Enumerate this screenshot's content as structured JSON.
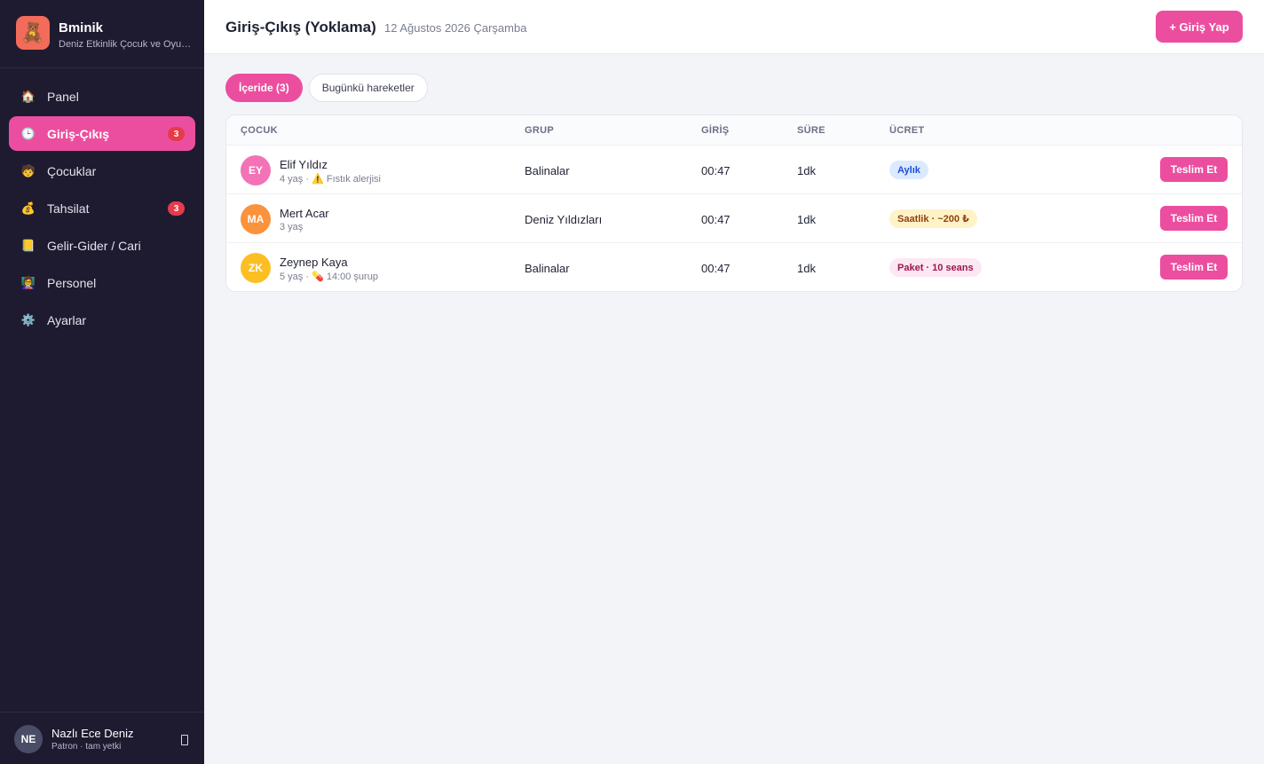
{
  "brand": {
    "logo_emoji": "🧸",
    "name": "Bminik",
    "subtitle": "Deniz Etkinlik Çocuk ve Oyun Merkezi"
  },
  "sidebar": {
    "items": [
      {
        "label": "Panel",
        "icon": "home-icon",
        "glyph": "🏠",
        "badge": ""
      },
      {
        "label": "Giriş-Çıkış",
        "icon": "clock-icon",
        "glyph": "🕒",
        "badge": "3",
        "active": true
      },
      {
        "label": "Çocuklar",
        "icon": "child-icon",
        "glyph": "🧒",
        "badge": ""
      },
      {
        "label": "Tahsilat",
        "icon": "money-bag-icon",
        "glyph": "💰",
        "badge": "3"
      },
      {
        "label": "Gelir-Gider / Cari",
        "icon": "ledger-icon",
        "glyph": "📒",
        "badge": ""
      },
      {
        "label": "Personel",
        "icon": "staff-icon",
        "glyph": "👩‍🏫",
        "badge": ""
      },
      {
        "label": "Ayarlar",
        "icon": "gear-icon",
        "glyph": "⚙️",
        "badge": ""
      }
    ]
  },
  "user": {
    "initials": "NE",
    "name": "Nazlı Ece Deniz",
    "role": "Patron · tam yetki"
  },
  "header": {
    "title": "Giriş-Çıkış (Yoklama)",
    "date": "12 Ağustos 2026 Çarşamba",
    "primary_button": "+ Giriş Yap"
  },
  "tabs": [
    {
      "label": "İçeride (3)",
      "active": true
    },
    {
      "label": "Bugünkü hareketler",
      "active": false
    }
  ],
  "table": {
    "columns": {
      "child": "ÇOCUK",
      "group": "GRUP",
      "checkin": "GİRİŞ",
      "duration": "SÜRE",
      "fee": "ÜCRET"
    },
    "rows": [
      {
        "initials": "EY",
        "avatar_color": "#f472b6",
        "name": "Elif Yıldız",
        "age": "4 yaş ·",
        "note_emoji": "⚠️",
        "note": "Fıstık alerjisi",
        "group": "Balinalar",
        "checkin": "00:47",
        "duration": "1dk",
        "fee": "Aylık",
        "fee_bg": "#dbeafe",
        "fee_color": "#1d4ed8",
        "action": "Teslim Et"
      },
      {
        "initials": "MA",
        "avatar_color": "#fb923c",
        "name": "Mert Acar",
        "age": "3 yaş",
        "note_emoji": "",
        "note": "",
        "group": "Deniz Yıldızları",
        "checkin": "00:47",
        "duration": "1dk",
        "fee": "Saatlik · ~200 ₺",
        "fee_bg": "#fef3c7",
        "fee_color": "#92400e",
        "action": "Teslim Et"
      },
      {
        "initials": "ZK",
        "avatar_color": "#fbbf24",
        "name": "Zeynep Kaya",
        "age": "5 yaş ·",
        "note_emoji": "💊",
        "note": "14:00 şurup",
        "group": "Balinalar",
        "checkin": "00:47",
        "duration": "1dk",
        "fee": "Paket · 10 seans",
        "fee_bg": "#fce7f3",
        "fee_color": "#9d174d",
        "action": "Teslim Et"
      }
    ]
  },
  "colors": {
    "accent": "#ec4e9f",
    "sidebar_bg": "#1e1b30",
    "badge": "#e53b4b"
  }
}
